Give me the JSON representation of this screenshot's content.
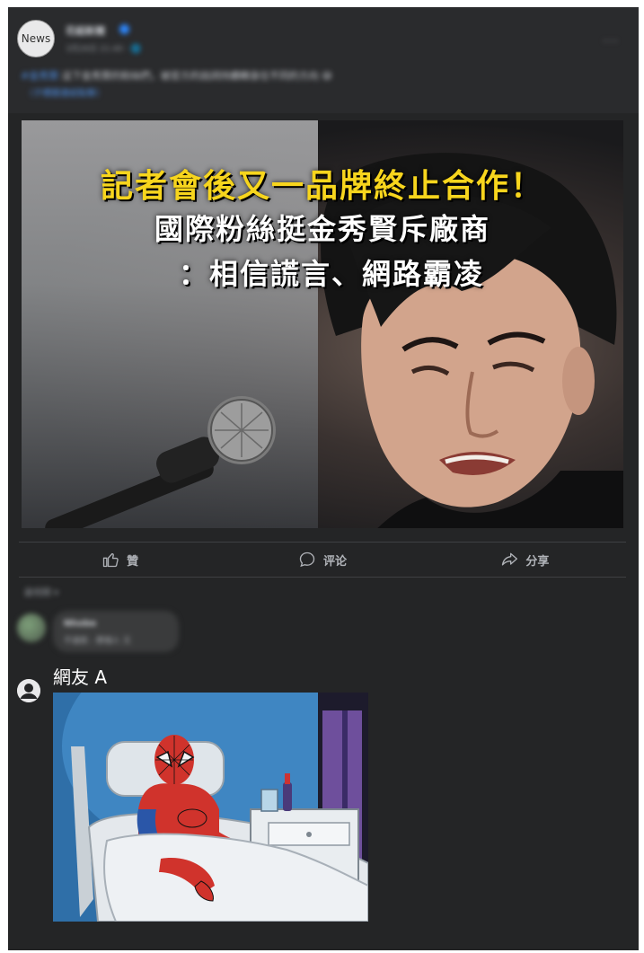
{
  "post": {
    "avatar_text": "News",
    "page_name": "花組新聞",
    "meta": "3月26日 21:40 · 🌐",
    "more_icon": "···",
    "text_tag": "#金秀賢",
    "text_body": " 這下金秀賢的粉絲們，被官方的說詞持續轉身往不同的方向 😅",
    "sub_link": "（子標題連結點擊）",
    "image": {
      "headline_1": "記者會後又一品牌終止合作！",
      "headline_2": "國際粉絲挺金秀賢斥廠商",
      "headline_3": "：相信謊言、網路霸凌"
    }
  },
  "actions": {
    "like": "贊",
    "comment": "评论",
    "share": "分享"
  },
  "comments": {
    "filter_label": "最相關 ▾",
    "first": {
      "name": "Nhobe",
      "text": "不過就 - 那個人 又"
    },
    "second": {
      "name": "網友 A"
    }
  }
}
